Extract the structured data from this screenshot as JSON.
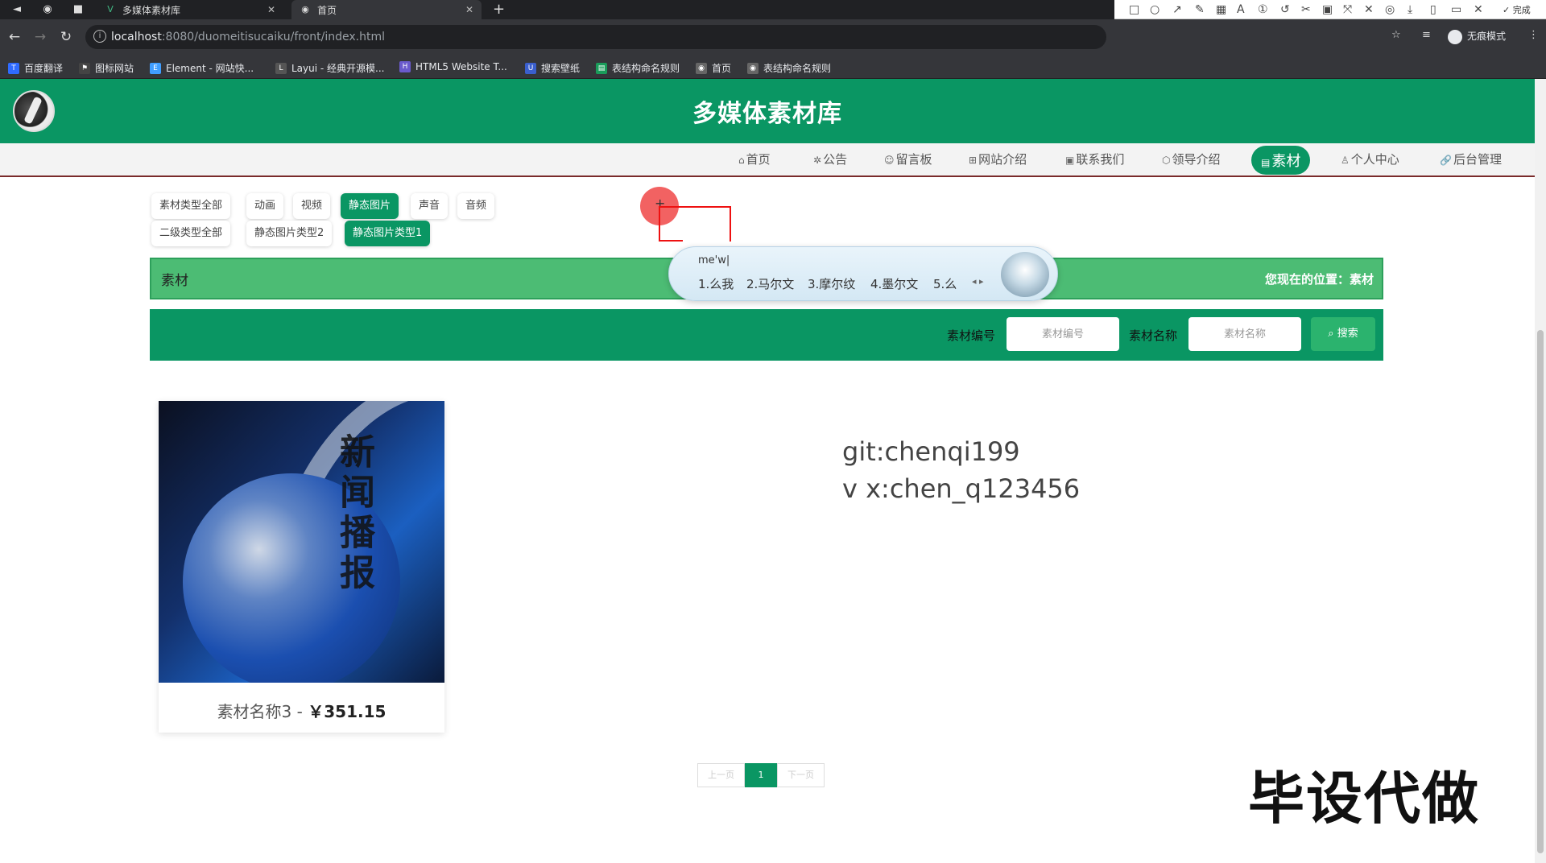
{
  "browser": {
    "tabs": [
      {
        "title": "多媒体素材库",
        "active": false
      },
      {
        "title": "首页",
        "active": true
      }
    ],
    "url_host": "localhost",
    "url_rest": ":8080/duomeitisucaiku/front/index.html",
    "profile_label": "无痕模式",
    "bookmarks": [
      "百度翻译",
      "图标网站",
      "Element - 网站快...",
      "Layui - 经典开源模...",
      "HTML5 Website T...",
      "搜索壁纸",
      "表结构命名规则",
      "首页",
      "表结构命名规则"
    ]
  },
  "annotation_tool": {
    "font_size": "20",
    "done_label": "完成",
    "selected_color": "#ff3b30"
  },
  "header": {
    "site_title": "多媒体素材库"
  },
  "nav": {
    "items": [
      {
        "icon": "home-icon",
        "label": "首页"
      },
      {
        "icon": "bell-icon",
        "label": "公告"
      },
      {
        "icon": "smile-icon",
        "label": "留言板"
      },
      {
        "icon": "site-icon",
        "label": "网站介绍"
      },
      {
        "icon": "phone-icon",
        "label": "联系我们"
      },
      {
        "icon": "shield-icon",
        "label": "领导介绍"
      },
      {
        "icon": "folder-icon",
        "label": "素材"
      },
      {
        "icon": "user-icon",
        "label": "个人中心"
      },
      {
        "icon": "link-icon",
        "label": "后台管理"
      }
    ],
    "active": "素材"
  },
  "filters": {
    "type_row": [
      "素材类型全部",
      "动画",
      "视频",
      "静态图片",
      "声音",
      "音频"
    ],
    "type_active": "静态图片",
    "subtype_row": [
      "二级类型全部",
      "静态图片类型2",
      "静态图片类型1"
    ],
    "subtype_active": "静态图片类型1"
  },
  "section_bar": {
    "title": "素材",
    "location": "您现在的位置：素材"
  },
  "search": {
    "code_label": "素材编号",
    "code_placeholder": "素材编号",
    "name_label": "素材名称",
    "name_placeholder": "素材名称",
    "button_label": "搜索"
  },
  "ime": {
    "composition": "me'w|",
    "candidates": [
      "1.么我",
      "2.马尔文",
      "3.摩尔纹",
      "4.墨尔文",
      "5.么"
    ]
  },
  "products": [
    {
      "thumb_text": "新闻播报",
      "name": "素材名称3",
      "separator": "-",
      "price": "￥351.15"
    }
  ],
  "contact": {
    "line1": "git:chenqi199",
    "line2": "v x:chen_q123456"
  },
  "pagination": {
    "prev": "上一页",
    "current": "1",
    "next": "下一页"
  },
  "watermark": "毕设代做",
  "colors": {
    "primary_green": "#0a9663",
    "light_green_bar": "#4cbc74"
  }
}
